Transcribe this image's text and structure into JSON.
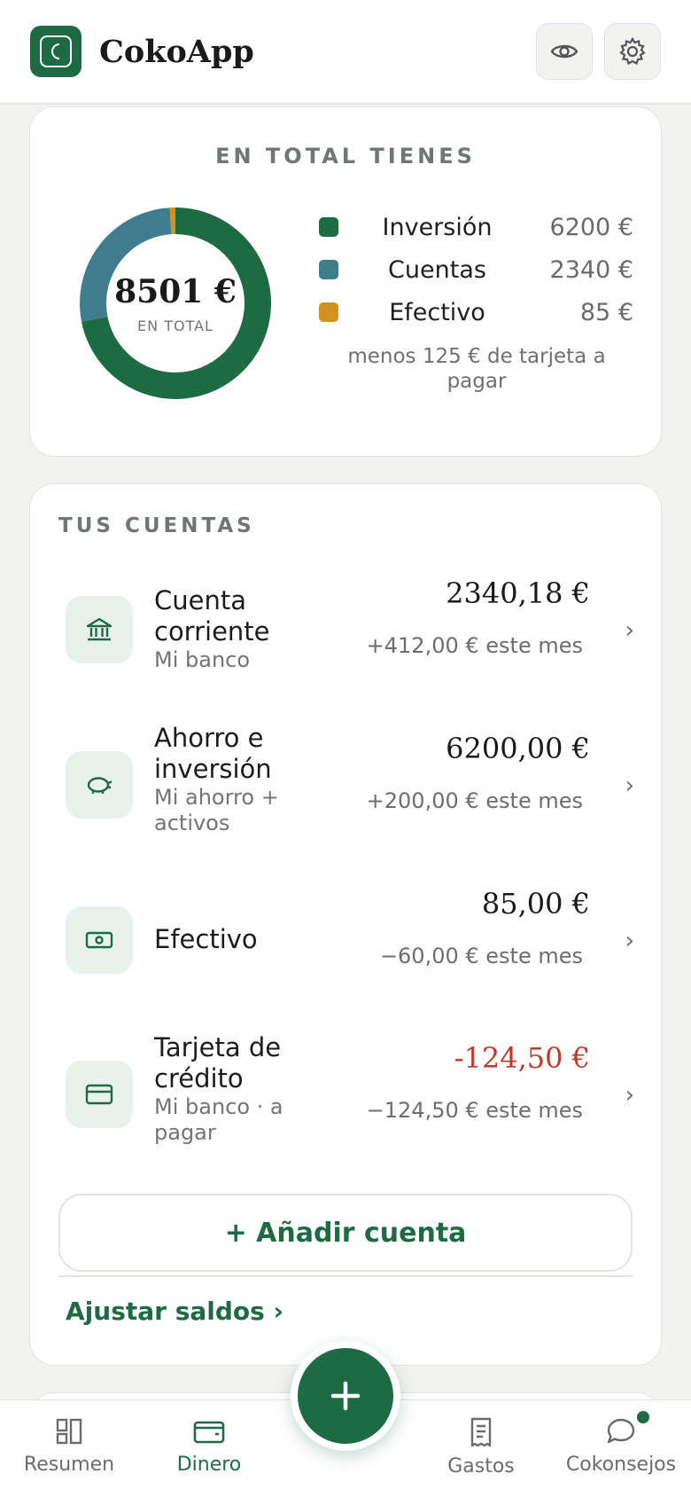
{
  "app": {
    "title": "CokoApp"
  },
  "colors": {
    "brand": "#1e6b43",
    "inversion": "#1e6b43",
    "cuentas": "#3f7d8e",
    "efectivo": "#d1921f",
    "negative": "#c0392b"
  },
  "header": {
    "icons": [
      "eye-icon",
      "gear-icon"
    ]
  },
  "total": {
    "label": "EN TOTAL TIENES",
    "amount": "8501 €",
    "amount_sub": "EN TOTAL",
    "legend": [
      {
        "name": "Inversión",
        "value": "6200 €"
      },
      {
        "name": "Cuentas",
        "value": "2340 €"
      },
      {
        "name": "Efectivo",
        "value": "85 €"
      }
    ],
    "note": "menos 125 € de tarjeta a pagar"
  },
  "chart_data": {
    "type": "pie",
    "categories": [
      "Inversión",
      "Cuentas",
      "Efectivo"
    ],
    "values": [
      6200,
      2340,
      85
    ],
    "title": "EN TOTAL TIENES",
    "center_label": "8501 €"
  },
  "accounts": {
    "label": "TUS CUENTAS",
    "items": [
      {
        "name": "Cuenta corriente",
        "sub": "Mi banco",
        "amount": "2340,18 €",
        "delta": "+412,00 € este mes",
        "icon": "bank-icon",
        "negative": false
      },
      {
        "name": "Ahorro e inversión",
        "sub": "Mi ahorro + activos",
        "amount": "6200,00 €",
        "delta": "+200,00 € este mes",
        "icon": "piggy-bank-icon",
        "negative": false
      },
      {
        "name": "Efectivo",
        "sub": "",
        "amount": "85,00 €",
        "delta": "−60,00 € este mes",
        "icon": "cash-icon",
        "negative": false
      },
      {
        "name": "Tarjeta de crédito",
        "sub": "Mi banco · a pagar",
        "amount": "-124,50 €",
        "delta": "−124,50 € este mes",
        "icon": "credit-card-icon",
        "negative": true
      }
    ],
    "add_label": "+ Añadir cuenta",
    "adjust_label": "Ajustar saldos ›"
  },
  "nav": {
    "items": [
      {
        "label": "Resumen",
        "icon": "summary-icon"
      },
      {
        "label": "Dinero",
        "icon": "wallet-icon",
        "active": true
      },
      {
        "label": "Gastos",
        "icon": "receipt-icon"
      },
      {
        "label": "Cokonsejos",
        "icon": "chat-bubble-icon"
      }
    ],
    "fab_icon": "plus-icon"
  }
}
